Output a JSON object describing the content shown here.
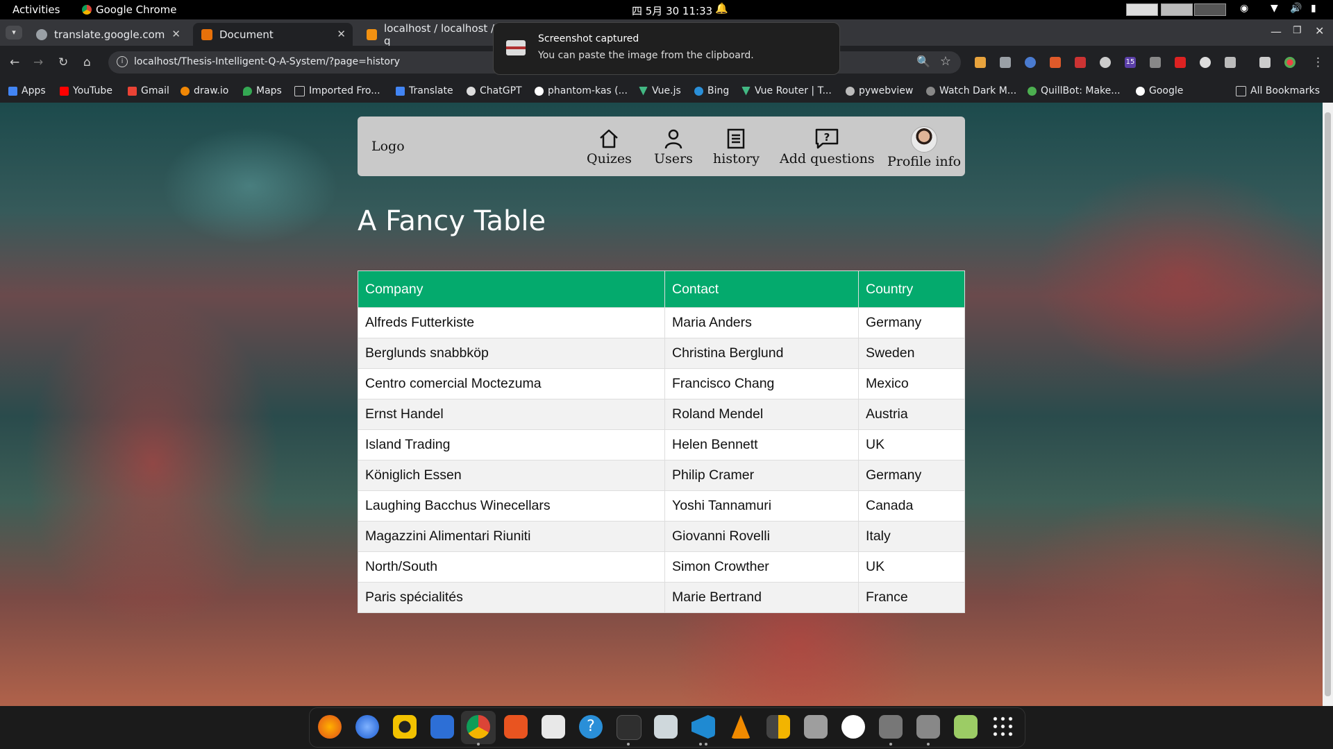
{
  "topbar": {
    "activities": "Activities",
    "app_name": "Google Chrome",
    "clock": "四 5月 30  11:33"
  },
  "tabs": [
    {
      "title": "translate.google.com",
      "active": false
    },
    {
      "title": "Document",
      "active": true
    },
    {
      "title": "localhost / localhost / q",
      "active": false
    }
  ],
  "address": {
    "url": "localhost/Thesis-Intelligent-Q-A-System/?page=history"
  },
  "bookmarks": [
    "Apps",
    "YouTube",
    "Gmail",
    "draw.io",
    "Maps",
    "Imported Fro...",
    "Translate",
    "ChatGPT",
    "phantom-kas (...",
    "Vue.js",
    "Bing",
    "Vue Router | T...",
    "pywebview",
    "Watch Dark M...",
    "QuillBot: Make...",
    "Google"
  ],
  "all_bookmarks": "All Bookmarks",
  "notification": {
    "title": "Screenshot captured",
    "body": "You can paste the image from the clipboard."
  },
  "extension_badge": "15",
  "navbar": {
    "logo": "Logo",
    "items": [
      "Quizes",
      "Users",
      "history",
      "Add questions",
      "Profile info"
    ]
  },
  "page_title": "A Fancy Table",
  "table": {
    "headers": [
      "Company",
      "Contact",
      "Country"
    ],
    "rows": [
      [
        "Alfreds Futterkiste",
        "Maria Anders",
        "Germany"
      ],
      [
        "Berglunds snabbköp",
        "Christina Berglund",
        "Sweden"
      ],
      [
        "Centro comercial Moctezuma",
        "Francisco Chang",
        "Mexico"
      ],
      [
        "Ernst Handel",
        "Roland Mendel",
        "Austria"
      ],
      [
        "Island Trading",
        "Helen Bennett",
        "UK"
      ],
      [
        "Königlich Essen",
        "Philip Cramer",
        "Germany"
      ],
      [
        "Laughing Bacchus Winecellars",
        "Yoshi Tannamuri",
        "Canada"
      ],
      [
        "Magazzini Alimentari Riuniti",
        "Giovanni Rovelli",
        "Italy"
      ],
      [
        "North/South",
        "Simon Crowther",
        "UK"
      ],
      [
        "Paris spécialités",
        "Marie Bertrand",
        "France"
      ]
    ]
  },
  "colors": {
    "table_header": "#04aa6d",
    "navbar_bg": "#c9c9c9"
  }
}
